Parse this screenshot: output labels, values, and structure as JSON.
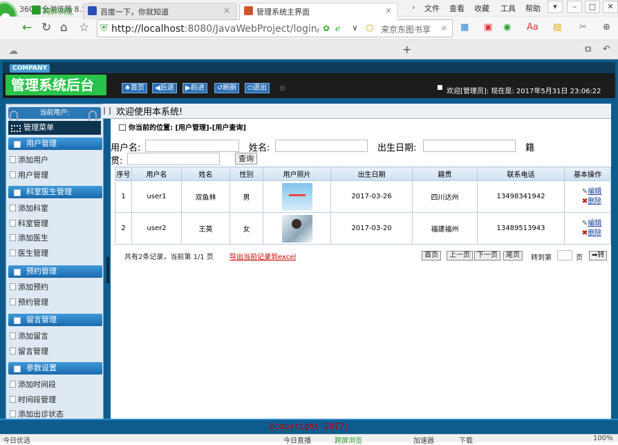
{
  "browser": {
    "name": "360安全浏览器 8.1",
    "menu": [
      "文件",
      "查看",
      "收藏",
      "工具",
      "帮助"
    ],
    "url_host": "http://localhost",
    "url_path": ":8080/JavaWebProject/login/lo",
    "search_placeholder": "来京东图书享",
    "tabs": [
      {
        "label": "跨屏浏览"
      },
      {
        "label": "百度一下，你就知道"
      },
      {
        "label": "管理系统主界面"
      }
    ]
  },
  "header": {
    "company": "COMPANY",
    "title": "管理系统后台",
    "nav": [
      "首页",
      "后退",
      "前进",
      "刷新",
      "退出"
    ],
    "welcome": "欢迎[管理员]:  现在是: 2017年5月31日 23:06:22"
  },
  "sidebar": {
    "current_user": "当前用户:",
    "menu_title": "管理菜单",
    "groups": [
      {
        "title": "用户管理",
        "items": [
          "添加用户",
          "用户管理"
        ]
      },
      {
        "title": "科室医生管理",
        "items": [
          "添加科室",
          "科室管理",
          "添加医生",
          "医生管理"
        ]
      },
      {
        "title": "预约管理",
        "items": [
          "添加预约",
          "预约管理"
        ]
      },
      {
        "title": "留言管理",
        "items": [
          "添加留言",
          "留言管理"
        ]
      },
      {
        "title": "参数设置",
        "items": [
          "添加时间段",
          "时间段管理",
          "添加出诊状态"
        ]
      }
    ]
  },
  "main": {
    "welcome": "欢迎使用本系统!",
    "position": "你当前的位置: [用户管理]-[用户查询]",
    "filters": {
      "username_label": "用户名:",
      "name_label": "姓名:",
      "birth_label": "出生日期:",
      "native_label_1": "籍",
      "native_label_2": "贯:",
      "query_button": "查询"
    },
    "table": {
      "headers": [
        "序号",
        "用户名",
        "姓名",
        "性别",
        "用户照片",
        "出生日期",
        "籍贯",
        "联系电话",
        "基本操作"
      ],
      "rows": [
        {
          "no": "1",
          "username": "user1",
          "name": "双鱼林",
          "gender": "男",
          "birth": "2017-03-26",
          "native": "四川达州",
          "phone": "13498341942"
        },
        {
          "no": "2",
          "username": "user2",
          "name": "王英",
          "gender": "女",
          "birth": "2017-03-20",
          "native": "福建福州",
          "phone": "13489513943"
        }
      ],
      "edit_label": "编辑",
      "delete_label": "删除"
    },
    "pager": {
      "summary": "共有2条记录，当前第 1/1 页",
      "export": "导出当前记录到excel",
      "first": "首页",
      "prev": "上一页",
      "next": "下一页",
      "last": "尾页",
      "goto_label": "转到第",
      "page_unit": "页",
      "go": "转"
    }
  },
  "footer": {
    "copyright": "@copyright 2017;"
  },
  "status": {
    "left": "今日优选",
    "middle": "今日直播",
    "browse": "跨屏浏览",
    "accel": "加速器",
    "download": "下载",
    "zoom": "100%"
  }
}
